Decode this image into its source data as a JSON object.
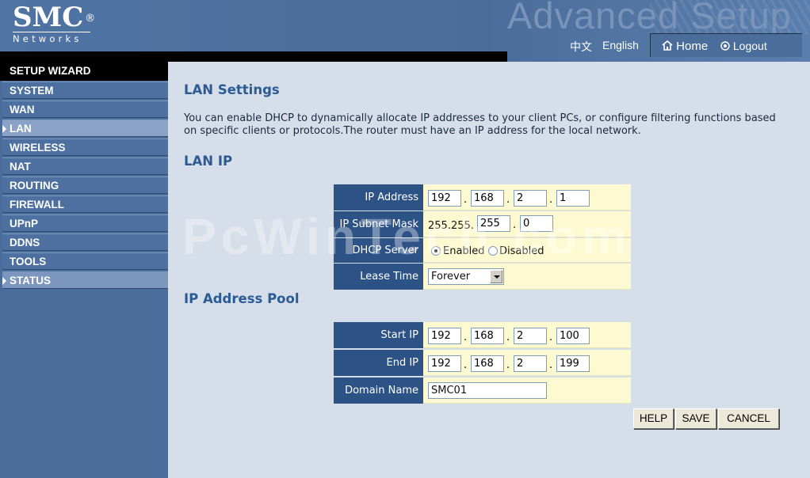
{
  "header": {
    "logo_main": "SMC",
    "logo_reg": "®",
    "logo_sub": "Networks",
    "banner_title": "Advanced Setup",
    "lang_cn": "中文",
    "lang_en": "English",
    "home_label": "Home",
    "logout_label": "Logout"
  },
  "sidebar": {
    "items": [
      {
        "label": "SETUP WIZARD"
      },
      {
        "label": "SYSTEM"
      },
      {
        "label": "WAN"
      },
      {
        "label": "LAN"
      },
      {
        "label": "WIRELESS"
      },
      {
        "label": "NAT"
      },
      {
        "label": "ROUTING"
      },
      {
        "label": "FIREWALL"
      },
      {
        "label": "UPnP"
      },
      {
        "label": "DDNS"
      },
      {
        "label": "TOOLS"
      },
      {
        "label": "STATUS"
      }
    ],
    "active": "LAN"
  },
  "main": {
    "title": "LAN Settings",
    "intro": "You can enable DHCP to dynamically allocate IP addresses to your client PCs, or configure filtering functions based on specific clients or protocols.The router must have an IP address for the local network.",
    "lan_ip_heading": "LAN IP",
    "lan_ip": {
      "ip_label": "IP Address",
      "ip": [
        "192",
        "168",
        "2",
        "1"
      ],
      "mask_label": "IP Subnet Mask",
      "mask_prefix": "255.255.",
      "mask": [
        "255",
        "0"
      ],
      "dhcp_label": "DHCP Server",
      "dhcp_enabled": "Enabled",
      "dhcp_disabled": "Disabled",
      "dhcp_value": "Enabled",
      "lease_label": "Lease Time",
      "lease_value": "Forever"
    },
    "pool_heading": "IP Address Pool",
    "pool": {
      "start_label": "Start IP",
      "start": [
        "192",
        "168",
        "2",
        "100"
      ],
      "end_label": "End IP",
      "end": [
        "192",
        "168",
        "2",
        "199"
      ],
      "domain_label": "Domain Name",
      "domain": "SMC01"
    },
    "buttons": {
      "help": "HELP",
      "save": "SAVE",
      "cancel": "CANCEL"
    }
  },
  "watermark": "PcWinTech.com"
}
